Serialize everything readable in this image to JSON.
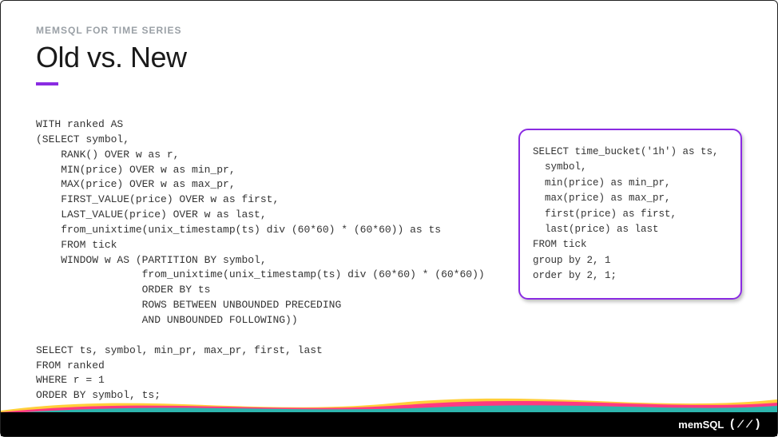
{
  "eyebrow": "MEMSQL FOR TIME SERIES",
  "title": "Old vs. New",
  "code_old": "WITH ranked AS\n(SELECT symbol,\n    RANK() OVER w as r,\n    MIN(price) OVER w as min_pr,\n    MAX(price) OVER w as max_pr,\n    FIRST_VALUE(price) OVER w as first,\n    LAST_VALUE(price) OVER w as last,\n    from_unixtime(unix_timestamp(ts) div (60*60) * (60*60)) as ts\n    FROM tick\n    WINDOW w AS (PARTITION BY symbol,\n                 from_unixtime(unix_timestamp(ts) div (60*60) * (60*60))\n                 ORDER BY ts\n                 ROWS BETWEEN UNBOUNDED PRECEDING\n                 AND UNBOUNDED FOLLOWING))\n\nSELECT ts, symbol, min_pr, max_pr, first, last\nFROM ranked\nWHERE r = 1\nORDER BY symbol, ts;",
  "code_new": "SELECT time_bucket('1h') as ts,\n  symbol,\n  min(price) as min_pr,\n  max(price) as max_pr,\n  first(price) as first,\n  last(price) as last\nFROM tick\ngroup by 2, 1\norder by 2, 1;",
  "brand": "memSQL",
  "colors": {
    "accent": "#8a2be2",
    "wave_pink": "#ff2e88",
    "wave_yellow": "#ffcf3a",
    "wave_teal": "#17c3b2",
    "footer_bg": "#000000"
  }
}
